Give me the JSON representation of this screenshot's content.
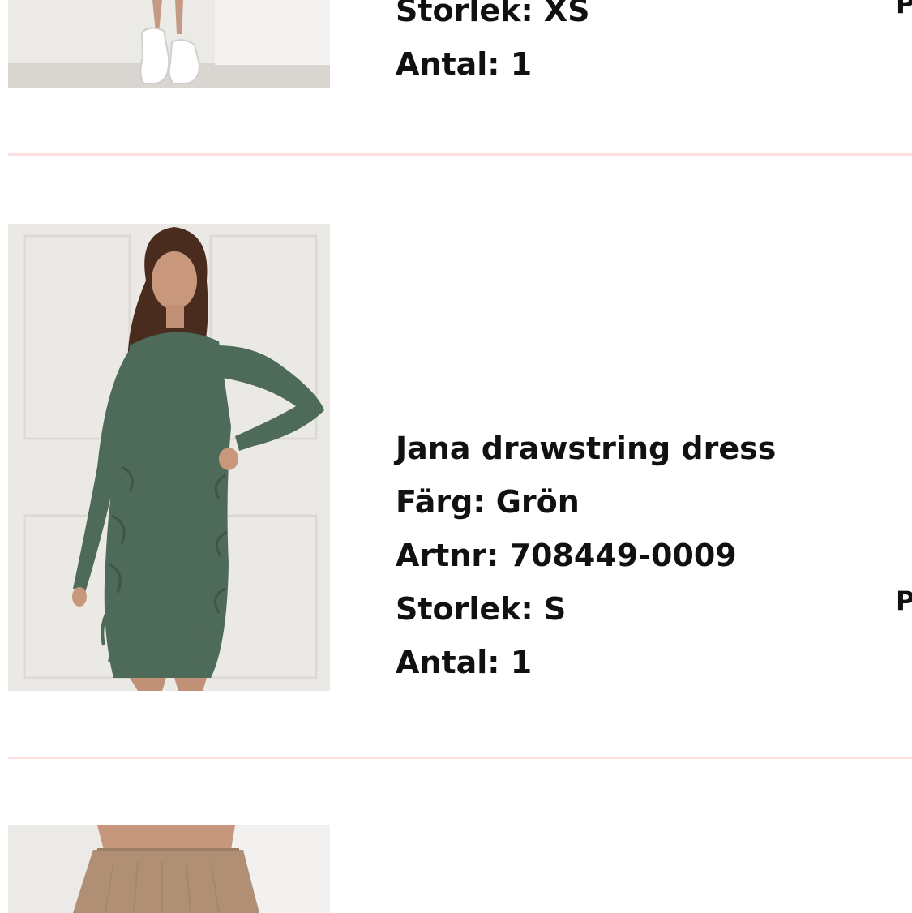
{
  "cart": {
    "items": [
      {
        "image_icon": "product-photo-white-sneakers",
        "size_line": "Storlek: XS",
        "quantity_line": "Antal: 1",
        "price_peek": "P"
      },
      {
        "image_icon": "product-photo-green-dress",
        "name": "Jana drawstring dress",
        "color_line": "Färg: Grön",
        "article_line": "Artnr: 708449-0009",
        "size_line": "Storlek: S",
        "quantity_line": "Antal: 1",
        "price_peek": "P"
      },
      {
        "image_icon": "product-photo-beige-skirt"
      }
    ]
  },
  "colors": {
    "divider": "#fbe0df",
    "text": "#111111",
    "dress_green": "#4e6a58",
    "skirt_beige": "#b08f74"
  }
}
